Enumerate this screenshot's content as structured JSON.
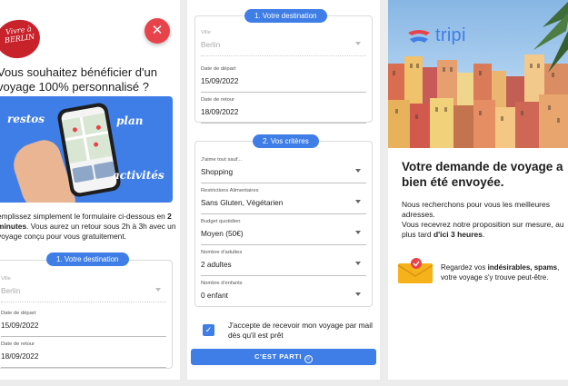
{
  "colors": {
    "accent": "#3f7ee6",
    "close": "#e8434b",
    "logo_red": "#c8222b"
  },
  "panel_left": {
    "logo_text": [
      "Vivre à",
      "BERLIN"
    ],
    "close_icon": "close-icon",
    "title": "Vous souhaitez bénéficier d'un voyage 100% personnalisé ?",
    "banner_words": {
      "restos": "restos",
      "plan": "plan",
      "activites": "activités"
    },
    "intro_before": "emplissez simplement le formulaire ci-dessous en ",
    "intro_bold": "2 minutes",
    "intro_after": ". Vous aurez un retour sous 2h à 3h avec un voyage conçu pour vous gratuitement.",
    "section_label": "1. Votre destination",
    "fields": {
      "ville": {
        "label": "Ville",
        "value": "Berlin"
      },
      "depart": {
        "label": "Date de départ",
        "value": "15/09/2022"
      },
      "retour": {
        "label": "Date de retour",
        "value": "18/09/2022"
      }
    }
  },
  "panel_middle": {
    "section1_label": "1. Votre destination",
    "section1_fields": {
      "ville": {
        "label": "Ville",
        "value": "Berlin"
      },
      "depart": {
        "label": "Date de départ",
        "value": "15/09/2022"
      },
      "retour": {
        "label": "Date de retour",
        "value": "18/09/2022"
      }
    },
    "section2_label": "2. Vos critères",
    "section2_fields": {
      "aime": {
        "label": "J'aime tout sauf...",
        "value": "Shopping"
      },
      "restrictions": {
        "label": "Restrictions Alimentaires",
        "value": "Sans Gluten, Végétarien"
      },
      "budget": {
        "label": "Budget quotidien",
        "value": "Moyen (50€)"
      },
      "adultes": {
        "label": "Nombre d'adultes",
        "value": "2 adultes"
      },
      "enfants": {
        "label": "Nombre d'enfants",
        "value": "0 enfant"
      }
    },
    "consent": "J'accepte de recevoir mon voyage par mail dès qu'il est prêt",
    "consent_checked": true,
    "submit_label": "C'EST PARTI",
    "submit_icon": "smile-icon"
  },
  "panel_right": {
    "brand": "tripi",
    "brand_icon": "tripi-logo-icon",
    "title": "Votre demande de voyage a bien été envoyée.",
    "text_line1": "Nous recherchons pour vous les meilleures adresses.",
    "text_line2": "Vous recevrez notre proposition sur mesure, au plus tard ",
    "text_bold": "d'ici 3 heures",
    "text_end": ".",
    "spam_before": "Regardez vos ",
    "spam_bold": "indésirables, spams",
    "spam_after": ", votre voyage s'y trouve peut-être.",
    "envelope_icon": "envelope-icon"
  }
}
